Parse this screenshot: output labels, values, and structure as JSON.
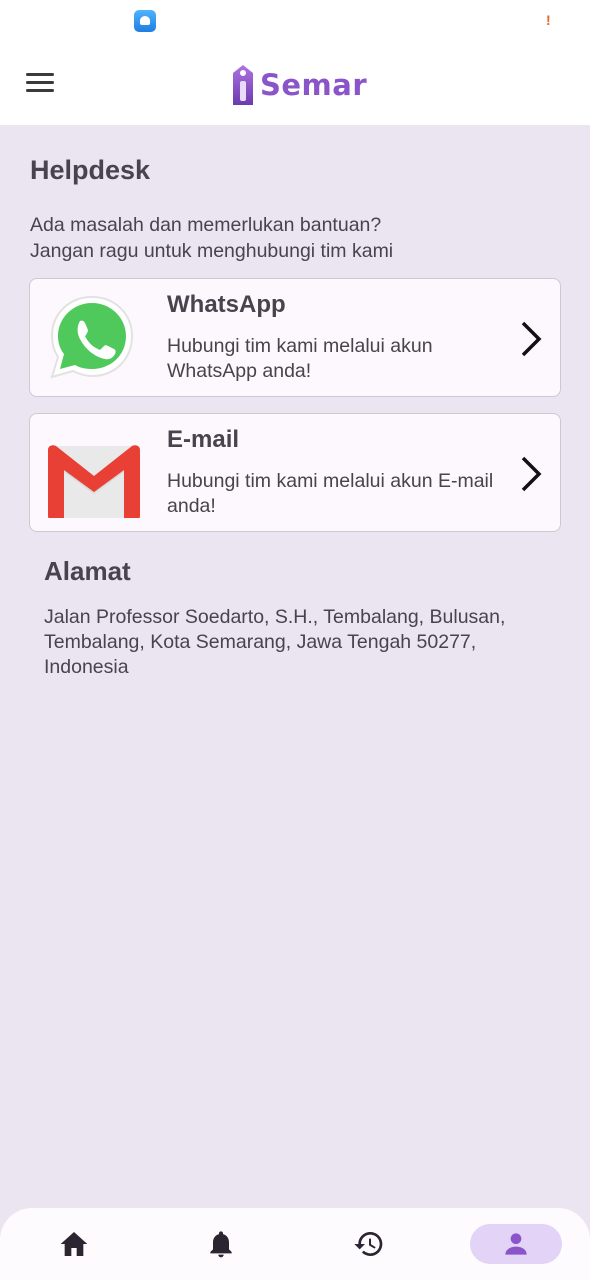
{
  "status_bar": {
    "alert_icon": "!"
  },
  "app": {
    "name": "Semar",
    "brand_color": "#8a55c9"
  },
  "page": {
    "title": "Helpdesk",
    "intro_line1": "Ada masalah dan memerlukan bantuan?",
    "intro_line2": "Jangan ragu untuk menghubungi tim kami"
  },
  "contacts": [
    {
      "title": "WhatsApp",
      "description": "Hubungi tim kami melalui akun WhatsApp anda!",
      "icon": "whatsapp-icon"
    },
    {
      "title": "E-mail",
      "description": "Hubungi tim kami melalui akun E-mail anda!",
      "icon": "gmail-icon"
    }
  ],
  "address": {
    "title": "Alamat",
    "text": "Jalan Professor Soedarto, S.H., Tembalang, Bulusan, Tembalang, Kota Semarang, Jawa Tengah 50277, Indonesia"
  },
  "bottom_nav": {
    "items": [
      "home-icon",
      "bell-icon",
      "history-icon",
      "profile-icon"
    ],
    "active": "profile-icon",
    "active_color": "#8a55c9"
  }
}
